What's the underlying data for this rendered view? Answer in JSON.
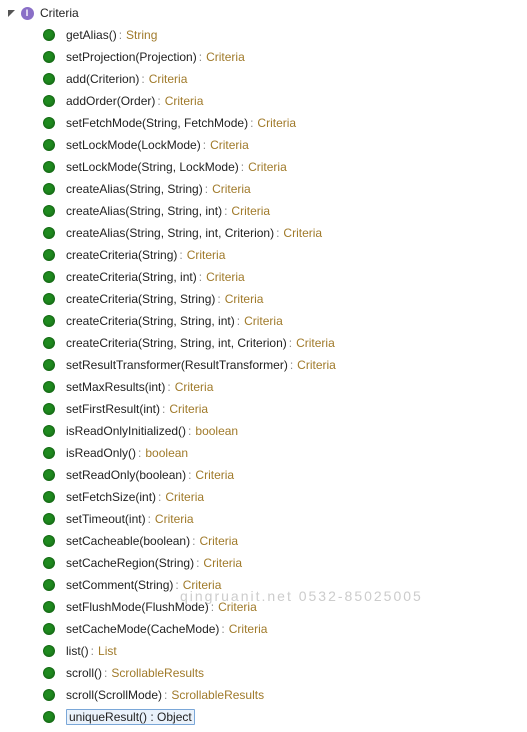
{
  "root": {
    "label": "Criteria"
  },
  "methods": [
    {
      "sig": "getAlias()",
      "ret": "String"
    },
    {
      "sig": "setProjection(Projection)",
      "ret": "Criteria"
    },
    {
      "sig": "add(Criterion)",
      "ret": "Criteria"
    },
    {
      "sig": "addOrder(Order)",
      "ret": "Criteria"
    },
    {
      "sig": "setFetchMode(String, FetchMode)",
      "ret": "Criteria"
    },
    {
      "sig": "setLockMode(LockMode)",
      "ret": "Criteria"
    },
    {
      "sig": "setLockMode(String, LockMode)",
      "ret": "Criteria"
    },
    {
      "sig": "createAlias(String, String)",
      "ret": "Criteria"
    },
    {
      "sig": "createAlias(String, String, int)",
      "ret": "Criteria"
    },
    {
      "sig": "createAlias(String, String, int, Criterion)",
      "ret": "Criteria"
    },
    {
      "sig": "createCriteria(String)",
      "ret": "Criteria"
    },
    {
      "sig": "createCriteria(String, int)",
      "ret": "Criteria"
    },
    {
      "sig": "createCriteria(String, String)",
      "ret": "Criteria"
    },
    {
      "sig": "createCriteria(String, String, int)",
      "ret": "Criteria"
    },
    {
      "sig": "createCriteria(String, String, int, Criterion)",
      "ret": "Criteria"
    },
    {
      "sig": "setResultTransformer(ResultTransformer)",
      "ret": "Criteria"
    },
    {
      "sig": "setMaxResults(int)",
      "ret": "Criteria"
    },
    {
      "sig": "setFirstResult(int)",
      "ret": "Criteria"
    },
    {
      "sig": "isReadOnlyInitialized()",
      "ret": "boolean"
    },
    {
      "sig": "isReadOnly()",
      "ret": "boolean"
    },
    {
      "sig": "setReadOnly(boolean)",
      "ret": "Criteria"
    },
    {
      "sig": "setFetchSize(int)",
      "ret": "Criteria"
    },
    {
      "sig": "setTimeout(int)",
      "ret": "Criteria"
    },
    {
      "sig": "setCacheable(boolean)",
      "ret": "Criteria"
    },
    {
      "sig": "setCacheRegion(String)",
      "ret": "Criteria"
    },
    {
      "sig": "setComment(String)",
      "ret": "Criteria"
    },
    {
      "sig": "setFlushMode(FlushMode)",
      "ret": "Criteria"
    },
    {
      "sig": "setCacheMode(CacheMode)",
      "ret": "Criteria"
    },
    {
      "sig": "list()",
      "ret": "List"
    },
    {
      "sig": "scroll()",
      "ret": "ScrollableResults"
    },
    {
      "sig": "scroll(ScrollMode)",
      "ret": "ScrollableResults"
    },
    {
      "sig": "uniqueResult()",
      "ret": "Object",
      "selected": true
    }
  ],
  "watermark": "qingruanit.net 0532-85025005"
}
